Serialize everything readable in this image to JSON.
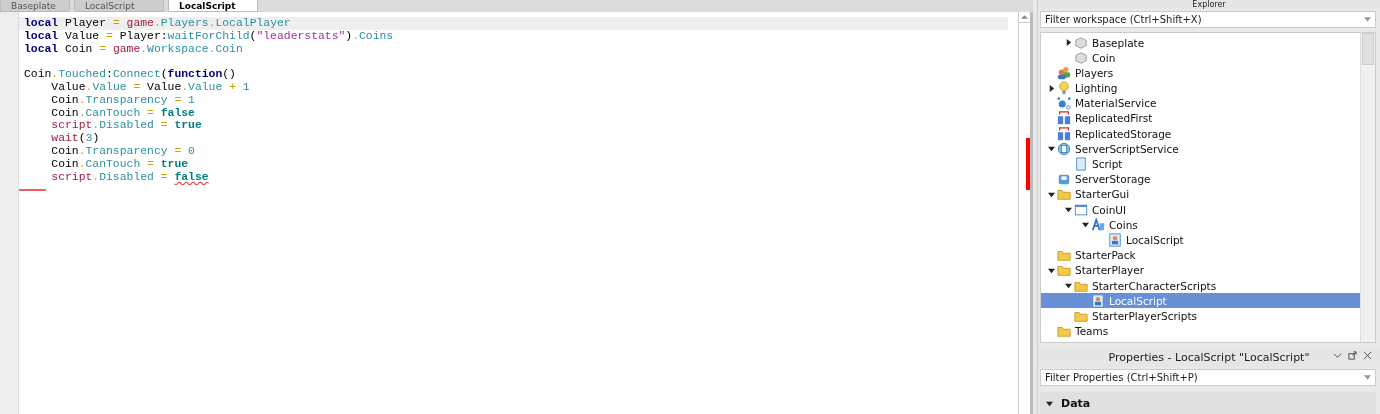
{
  "tabs": [
    {
      "label": "Baseplate",
      "selected": false
    },
    {
      "label": "LocalScript",
      "selected": false
    },
    {
      "label": "LocalScript",
      "selected": true
    }
  ],
  "editor": {
    "lines": [
      {
        "highlighted": true,
        "tokens": [
          {
            "kind": "kw",
            "text": "local"
          },
          {
            "kind": "plain",
            "text": " Player"
          },
          {
            "kind": "op",
            "text": " = "
          },
          {
            "kind": "global",
            "text": "game"
          },
          {
            "kind": "op",
            "text": "."
          },
          {
            "kind": "member",
            "text": "Players"
          },
          {
            "kind": "op",
            "text": "."
          },
          {
            "kind": "member",
            "text": "LocalPlayer"
          }
        ]
      },
      {
        "highlighted": false,
        "tokens": [
          {
            "kind": "kw",
            "text": "local"
          },
          {
            "kind": "plain",
            "text": " Value"
          },
          {
            "kind": "op",
            "text": " = "
          },
          {
            "kind": "plain",
            "text": "Player:"
          },
          {
            "kind": "member",
            "text": "waitForChild"
          },
          {
            "kind": "plain",
            "text": "("
          },
          {
            "kind": "str",
            "text": "\"leaderstats\""
          },
          {
            "kind": "plain",
            "text": ")"
          },
          {
            "kind": "op",
            "text": "."
          },
          {
            "kind": "member",
            "text": "Coins"
          }
        ]
      },
      {
        "highlighted": false,
        "tokens": [
          {
            "kind": "kw",
            "text": "local"
          },
          {
            "kind": "plain",
            "text": " Coin"
          },
          {
            "kind": "op",
            "text": " = "
          },
          {
            "kind": "global",
            "text": "game"
          },
          {
            "kind": "op",
            "text": "."
          },
          {
            "kind": "member",
            "text": "Workspace"
          },
          {
            "kind": "op",
            "text": "."
          },
          {
            "kind": "member",
            "text": "Coin"
          }
        ]
      },
      {
        "highlighted": false
      },
      {
        "highlighted": false,
        "tokens": [
          {
            "kind": "plain",
            "text": "Coin"
          },
          {
            "kind": "op",
            "text": "."
          },
          {
            "kind": "member",
            "text": "Touched"
          },
          {
            "kind": "plain",
            "text": ":"
          },
          {
            "kind": "member",
            "text": "Connect"
          },
          {
            "kind": "plain",
            "text": "("
          },
          {
            "kind": "kw",
            "text": "function"
          },
          {
            "kind": "plain",
            "text": "()"
          }
        ]
      },
      {
        "highlighted": false,
        "tokens": [
          {
            "kind": "plain",
            "text": "    Value"
          },
          {
            "kind": "op",
            "text": "."
          },
          {
            "kind": "member",
            "text": "Value"
          },
          {
            "kind": "op",
            "text": " = "
          },
          {
            "kind": "plain",
            "text": "Value"
          },
          {
            "kind": "op",
            "text": "."
          },
          {
            "kind": "member",
            "text": "Value"
          },
          {
            "kind": "op",
            "text": " + "
          },
          {
            "kind": "num",
            "text": "1"
          }
        ]
      },
      {
        "highlighted": false,
        "tokens": [
          {
            "kind": "plain",
            "text": "    Coin"
          },
          {
            "kind": "op",
            "text": "."
          },
          {
            "kind": "member",
            "text": "Transparency"
          },
          {
            "kind": "op",
            "text": " = "
          },
          {
            "kind": "num",
            "text": "1"
          }
        ]
      },
      {
        "highlighted": false,
        "tokens": [
          {
            "kind": "plain",
            "text": "    Coin"
          },
          {
            "kind": "op",
            "text": "."
          },
          {
            "kind": "member",
            "text": "CanTouch"
          },
          {
            "kind": "op",
            "text": " = "
          },
          {
            "kind": "bool",
            "text": "false"
          }
        ]
      },
      {
        "highlighted": false,
        "tokens": [
          {
            "kind": "global",
            "text": "    script"
          },
          {
            "kind": "op",
            "text": "."
          },
          {
            "kind": "member",
            "text": "Disabled"
          },
          {
            "kind": "op",
            "text": " = "
          },
          {
            "kind": "bool",
            "text": "true"
          }
        ]
      },
      {
        "highlighted": false,
        "tokens": [
          {
            "kind": "global",
            "text": "    wait"
          },
          {
            "kind": "plain",
            "text": "("
          },
          {
            "kind": "num",
            "text": "3"
          },
          {
            "kind": "plain",
            "text": ")"
          }
        ]
      },
      {
        "highlighted": false,
        "tokens": [
          {
            "kind": "plain",
            "text": "    Coin"
          },
          {
            "kind": "op",
            "text": "."
          },
          {
            "kind": "member",
            "text": "Transparency"
          },
          {
            "kind": "op",
            "text": " = "
          },
          {
            "kind": "num",
            "text": "0"
          }
        ]
      },
      {
        "highlighted": false,
        "tokens": [
          {
            "kind": "plain",
            "text": "    Coin"
          },
          {
            "kind": "op",
            "text": "."
          },
          {
            "kind": "member",
            "text": "CanTouch"
          },
          {
            "kind": "op",
            "text": " = "
          },
          {
            "kind": "bool",
            "text": "true"
          }
        ]
      },
      {
        "highlighted": false,
        "tokens": [
          {
            "kind": "global",
            "text": "    script"
          },
          {
            "kind": "op",
            "text": "."
          },
          {
            "kind": "member",
            "text": "Disabled"
          },
          {
            "kind": "op",
            "text": " = "
          },
          {
            "kind": "bool",
            "text": "false",
            "error": true
          }
        ]
      },
      {
        "highlighted": false,
        "error": true
      }
    ]
  },
  "explorer": {
    "title": "Explorer",
    "filter": {
      "placeholder": "Filter workspace (Ctrl+Shift+X)"
    },
    "partial_children": [
      {
        "label": "Baseplate",
        "kind": "part",
        "selected": false,
        "expanded": false
      },
      {
        "label": "Coin",
        "kind": "part",
        "selected": false
      }
    ],
    "items": [
      {
        "label": "Players",
        "kind": "players",
        "selected": false
      },
      {
        "label": "Lighting",
        "kind": "lighting",
        "selected": false,
        "expanded": false
      },
      {
        "label": "MaterialService",
        "kind": "material",
        "selected": false
      },
      {
        "label": "ReplicatedFirst",
        "kind": "replicated",
        "selected": false
      },
      {
        "label": "ReplicatedStorage",
        "kind": "replicated",
        "selected": false
      },
      {
        "label": "ServerScriptService",
        "kind": "script-service",
        "selected": false,
        "expanded": true,
        "children": [
          {
            "label": "Script",
            "kind": "script",
            "selected": false
          }
        ]
      },
      {
        "label": "ServerStorage",
        "kind": "storage",
        "selected": false
      },
      {
        "label": "StarterGui",
        "kind": "folder",
        "selected": false,
        "expanded": true,
        "children": [
          {
            "label": "CoinUI",
            "kind": "screen-gui",
            "selected": false,
            "expanded": true,
            "children": [
              {
                "label": "Coins",
                "kind": "text-label",
                "selected": false,
                "expanded": true,
                "children": [
                  {
                    "label": "LocalScript",
                    "kind": "local-script",
                    "selected": false
                  }
                ]
              }
            ]
          }
        ]
      },
      {
        "label": "StarterPack",
        "kind": "folder",
        "selected": false
      },
      {
        "label": "StarterPlayer",
        "kind": "folder",
        "selected": false,
        "expanded": true,
        "children": [
          {
            "label": "StarterCharacterScripts",
            "kind": "folder",
            "selected": false,
            "expanded": true,
            "children": [
              {
                "label": "LocalScript",
                "kind": "local-script",
                "selected": true
              }
            ]
          },
          {
            "label": "StarterPlayerScripts",
            "kind": "folder",
            "selected": false
          }
        ]
      },
      {
        "label": "Teams",
        "kind": "folder",
        "selected": false
      }
    ]
  },
  "properties": {
    "title": "Properties - LocalScript \"LocalScript\"",
    "filter": {
      "placeholder": "Filter Properties (Ctrl+Shift+P)"
    },
    "categories": [
      {
        "label": "Data",
        "expanded": true
      }
    ]
  }
}
